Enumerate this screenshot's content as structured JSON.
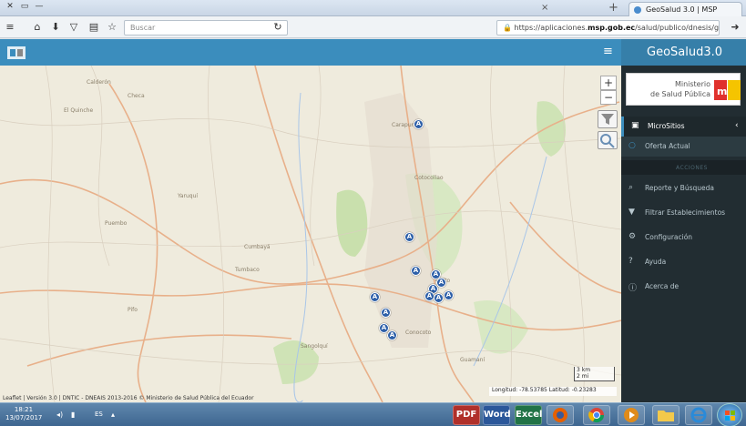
{
  "browser": {
    "tab_title": "GeoSalud 3.0 | MSP",
    "search_placeholder": "Buscar",
    "url_prefix": "https://aplicaciones.",
    "url_domain": "msp.gob.ec",
    "url_path": "/salud/publico/dnesis/geosalud/gui/"
  },
  "app": {
    "brand": "GeoSalud3.0",
    "menu_icon": "hamburger-icon"
  },
  "sidebar": {
    "logo_text_1": "Ministerio",
    "logo_text_2": "de Salud Pública",
    "logo_mark": "msp",
    "items": [
      {
        "label": "MicroSitios",
        "icon": "map-icon"
      },
      {
        "label": "Oferta Actual",
        "icon": "circle-icon"
      },
      {
        "label": "Reporte y Búsqueda",
        "icon": "search-icon"
      },
      {
        "label": "Filtrar Establecimientos",
        "icon": "filter-icon"
      },
      {
        "label": "Configuración",
        "icon": "gears-icon"
      },
      {
        "label": "Ayuda",
        "icon": "help-icon"
      },
      {
        "label": "Acerca de",
        "icon": "info-icon"
      }
    ],
    "section_header": "ACCIONES"
  },
  "map": {
    "zoom_in": "+",
    "zoom_out": "−",
    "marker_letter": "A",
    "scale_top": "3 km",
    "scale_bottom": "2 mi",
    "coords": "Longitud: -78.53785 Latitud: -0.23283",
    "credit": "Leaflet | Versión 3.0 | DNTIC - DNEAIS 2013-2016 © Ministerio de Salud Pública del Ecuador",
    "place_labels": [
      "El Quinche",
      "Calderón",
      "Cumbayá",
      "Tumbaco",
      "Conocoto",
      "Sangolquí",
      "Guamaní",
      "Puembo",
      "Pifo",
      "Carapungo",
      "Cotocollao",
      "Checa",
      "Yaruquí",
      "Quito"
    ]
  },
  "taskbar": {
    "time": "18:21",
    "date": "13/07/2017",
    "lang": "ES",
    "apps": [
      "IE",
      "Firefox",
      "Chrome",
      "Excel",
      "Word",
      "PDF"
    ]
  }
}
